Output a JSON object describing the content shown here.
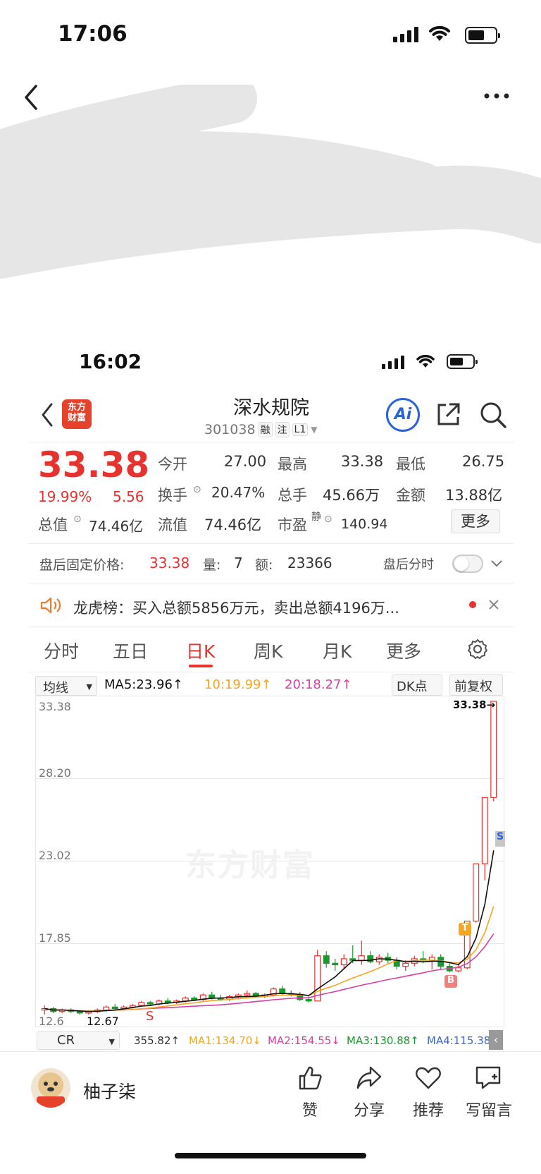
{
  "outer_status": {
    "time": "17:06"
  },
  "inner_status": {
    "time": "16:02"
  },
  "stock": {
    "name": "深水规院",
    "code": "301038",
    "tags": [
      "融",
      "注",
      "L1"
    ],
    "logo_text": "东方财富",
    "ai_label": "Ai",
    "price": "33.38",
    "change_pct": "19.99%",
    "change": "5.56"
  },
  "quotes": {
    "open_label": "今开",
    "open": "27.00",
    "high_label": "最高",
    "high": "33.38",
    "low_label": "最低",
    "low": "26.75",
    "turnover_label": "换手",
    "turnover": "20.47%",
    "volume_label": "总手",
    "volume": "45.66万",
    "amount_label": "金额",
    "amount": "13.88亿",
    "mktcap_label": "总值",
    "mktcap": "74.46亿",
    "float_label": "流值",
    "float": "74.46亿",
    "pe_label": "市盈",
    "pe_sup": "静",
    "pe": "140.94",
    "more": "更多"
  },
  "after_hours": {
    "label": "盘后固定价格:",
    "price": "33.38",
    "vol_label": "量:",
    "vol": "7",
    "amt_label": "额:",
    "amt": "23366",
    "toggle_label": "盘后分时"
  },
  "notice": {
    "text": "龙虎榜：买入总额5856万元，卖出总额4196万..."
  },
  "tabs": [
    "分时",
    "五日",
    "日K",
    "周K",
    "月K",
    "更多"
  ],
  "ma_bar": {
    "select": "均线",
    "ma5": "MA5:23.96↑",
    "ma10": "10:19.99↑",
    "ma20": "20:18.27↑",
    "dk": "DK点",
    "fq": "前复权"
  },
  "chart_axis": {
    "y1": "33.38",
    "y2": "28.20",
    "y3": "23.02",
    "y4": "17.85",
    "y5": "12.6",
    "last": "33.38→",
    "low": "12.67",
    "watermark": "东方财富"
  },
  "signals": {
    "s1": "S",
    "s2": "S",
    "t": "T",
    "b": "B"
  },
  "cr_bar": {
    "select": "CR",
    "cr": "355.82↑",
    "ma1": "MA1:134.70↓",
    "ma2": "MA2:154.55↓",
    "ma3": "MA3:130.88↑",
    "ma4": "MA4:115.38"
  },
  "colors": {
    "up": "#e8322f",
    "down": "#1a9a2e",
    "ma5": "#111111",
    "ma10": "#f5a623",
    "ma20": "#d63fa3"
  },
  "chart_data": {
    "type": "candlestick",
    "series": [
      {
        "name": "MA5",
        "note": "daily K-line, prices approximated",
        "values": []
      }
    ],
    "candles": [
      [
        12.9,
        13.2,
        12.6,
        13.0
      ],
      [
        13.0,
        13.1,
        12.7,
        12.8
      ],
      [
        12.8,
        13.0,
        12.7,
        12.9
      ],
      [
        12.9,
        13.0,
        12.7,
        12.8
      ],
      [
        12.8,
        12.9,
        12.6,
        12.7
      ],
      [
        12.7,
        12.9,
        12.6,
        12.8
      ],
      [
        12.8,
        13.0,
        12.7,
        12.9
      ],
      [
        12.9,
        13.2,
        12.8,
        13.1
      ],
      [
        13.1,
        13.3,
        12.9,
        13.0
      ],
      [
        13.0,
        13.2,
        12.9,
        13.1
      ],
      [
        13.1,
        13.3,
        13.0,
        13.2
      ],
      [
        13.2,
        13.5,
        13.1,
        13.4
      ],
      [
        13.4,
        13.5,
        13.2,
        13.3
      ],
      [
        13.3,
        13.6,
        13.2,
        13.5
      ],
      [
        13.5,
        13.7,
        13.3,
        13.4
      ],
      [
        13.4,
        13.6,
        13.3,
        13.5
      ],
      [
        13.5,
        13.8,
        13.4,
        13.7
      ],
      [
        13.7,
        13.8,
        13.5,
        13.6
      ],
      [
        13.6,
        14.0,
        13.5,
        13.9
      ],
      [
        13.9,
        14.1,
        13.6,
        13.7
      ],
      [
        13.7,
        13.9,
        13.5,
        13.6
      ],
      [
        13.6,
        13.9,
        13.5,
        13.8
      ],
      [
        13.8,
        14.0,
        13.6,
        13.9
      ],
      [
        13.9,
        14.2,
        13.8,
        14.0
      ],
      [
        14.0,
        14.1,
        13.7,
        13.8
      ],
      [
        13.8,
        14.0,
        13.7,
        13.9
      ],
      [
        13.9,
        14.4,
        13.8,
        14.3
      ],
      [
        14.3,
        14.5,
        13.9,
        14.0
      ],
      [
        14.0,
        14.2,
        13.8,
        13.9
      ],
      [
        13.9,
        14.1,
        13.5,
        13.6
      ],
      [
        13.6,
        13.8,
        13.4,
        13.5
      ],
      [
        13.5,
        16.9,
        13.5,
        16.5
      ],
      [
        16.5,
        16.8,
        15.7,
        16.0
      ],
      [
        16.0,
        16.3,
        15.5,
        15.9
      ],
      [
        15.9,
        16.6,
        15.6,
        16.3
      ],
      [
        16.3,
        17.2,
        16.0,
        16.2
      ],
      [
        16.2,
        17.5,
        15.9,
        16.5
      ],
      [
        16.5,
        16.8,
        16.0,
        16.1
      ],
      [
        16.1,
        16.6,
        15.9,
        16.4
      ],
      [
        16.4,
        16.7,
        16.0,
        16.2
      ],
      [
        16.2,
        16.4,
        15.6,
        15.8
      ],
      [
        15.8,
        16.2,
        15.5,
        16.0
      ],
      [
        16.0,
        16.5,
        15.8,
        16.3
      ],
      [
        16.3,
        16.8,
        16.0,
        16.2
      ],
      [
        16.2,
        16.6,
        15.6,
        16.4
      ],
      [
        16.4,
        16.6,
        15.6,
        15.8
      ],
      [
        15.8,
        16.0,
        15.4,
        15.5
      ],
      [
        15.5,
        15.9,
        15.4,
        15.7
      ],
      [
        15.7,
        18.8,
        15.6,
        18.8
      ],
      [
        18.8,
        22.6,
        18.7,
        22.6
      ],
      [
        22.6,
        27.0,
        21.5,
        27.0
      ],
      [
        27.0,
        33.38,
        26.75,
        33.38
      ]
    ],
    "ylim": [
      12.6,
      33.38
    ],
    "yticks": [
      "33.38",
      "28.20",
      "23.02",
      "17.85",
      "12.6"
    ]
  }
}
